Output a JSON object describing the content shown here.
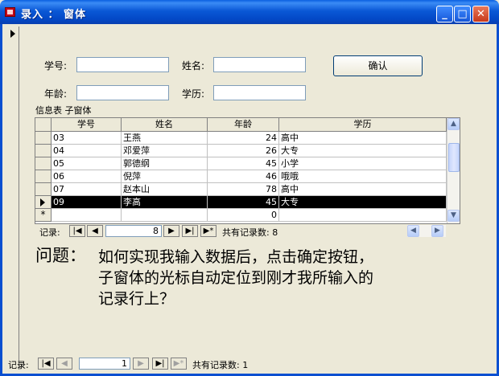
{
  "window": {
    "title": "录入 ： 窗体",
    "controls": {
      "minimize": "_",
      "maximize": "□",
      "close": "✕"
    }
  },
  "form": {
    "fields": [
      {
        "label": "学号:",
        "value": ""
      },
      {
        "label": "姓名:",
        "value": ""
      },
      {
        "label": "年龄:",
        "value": ""
      },
      {
        "label": "学历:",
        "value": ""
      }
    ],
    "confirm_button": "确认",
    "subform_label": "信息表 子窗体"
  },
  "subform": {
    "columns": [
      "学号",
      "姓名",
      "年龄",
      "学历"
    ],
    "rows": [
      {
        "id": "03",
        "name": "王燕",
        "age": "24",
        "edu": "高中",
        "selected": false
      },
      {
        "id": "04",
        "name": "邓爱萍",
        "age": "26",
        "edu": "大专",
        "selected": false
      },
      {
        "id": "05",
        "name": "郭德纲",
        "age": "45",
        "edu": "小学",
        "selected": false
      },
      {
        "id": "06",
        "name": "倪萍",
        "age": "46",
        "edu": "哦哦",
        "selected": false
      },
      {
        "id": "07",
        "name": "赵本山",
        "age": "78",
        "edu": "高中",
        "selected": false
      },
      {
        "id": "09",
        "name": "李高",
        "age": "45",
        "edu": "大专",
        "selected": true
      }
    ],
    "new_row": {
      "marker": "*",
      "age": "0"
    },
    "nav": {
      "label": "记录:",
      "current": "8",
      "total_text": "共有记录数: 8"
    }
  },
  "question": {
    "prefix": "问题：",
    "lines": [
      "如何实现我输入数据后，点击确定按钮，",
      "子窗体的光标自动定位到刚才我所输入的",
      "记录行上？"
    ]
  },
  "main_nav": {
    "label": "记录:",
    "current": "1",
    "total_text": "共有记录数: 1"
  }
}
